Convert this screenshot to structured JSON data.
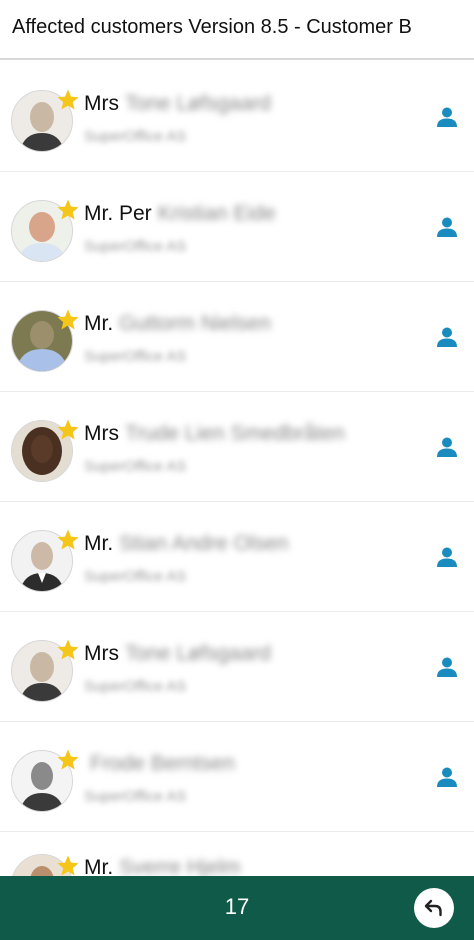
{
  "header": {
    "title": "Affected customers Version 8.5 - Customer B"
  },
  "contacts": [
    {
      "title": "Mrs",
      "name": "Tone Løfsgaard",
      "company": "SuperOffice AS",
      "avatar_color": "#c9b9a4",
      "shirt_color": "#3a3a3a"
    },
    {
      "title": "Mr. Per",
      "name": "Kristian Eide",
      "company": "SuperOffice AS",
      "avatar_color": "#d8a58a",
      "shirt_color": "#d9e5f3"
    },
    {
      "title": "Mr.",
      "name": "Guttorm Nielsen",
      "company": "SuperOffice AS",
      "avatar_color": "#9c8f6c",
      "shirt_color": "#a9c1e8"
    },
    {
      "title": "Mrs",
      "name": "Trude Lien Smedbråten",
      "company": "SuperOffice AS",
      "avatar_color": "#5a3b2a",
      "shirt_color": "#4a3020"
    },
    {
      "title": "Mr.",
      "name": "Stian Andre Olsen",
      "company": "SuperOffice AS",
      "avatar_color": "#cdb9a8",
      "shirt_color": "#2c2c2c"
    },
    {
      "title": "Mrs",
      "name": "Tone Løfsgaard",
      "company": "SuperOffice AS",
      "avatar_color": "#c9b9a4",
      "shirt_color": "#3a3a3a"
    },
    {
      "title": "",
      "name": "Frode Berntsen",
      "company": "SuperOffice AS",
      "avatar_color": "#8a8a8a",
      "shirt_color": "#3a3a3a"
    }
  ],
  "partial_contact": {
    "title": "Mr.",
    "name": "Sverre Hjelm"
  },
  "footer": {
    "count": "17"
  },
  "colors": {
    "accent": "#1a8bbf",
    "footer_bg": "#0f5a48",
    "star": "#f5c518"
  },
  "icons": {
    "favorite": "star-icon",
    "contact": "person-icon",
    "back": "undo-arrow-icon"
  }
}
